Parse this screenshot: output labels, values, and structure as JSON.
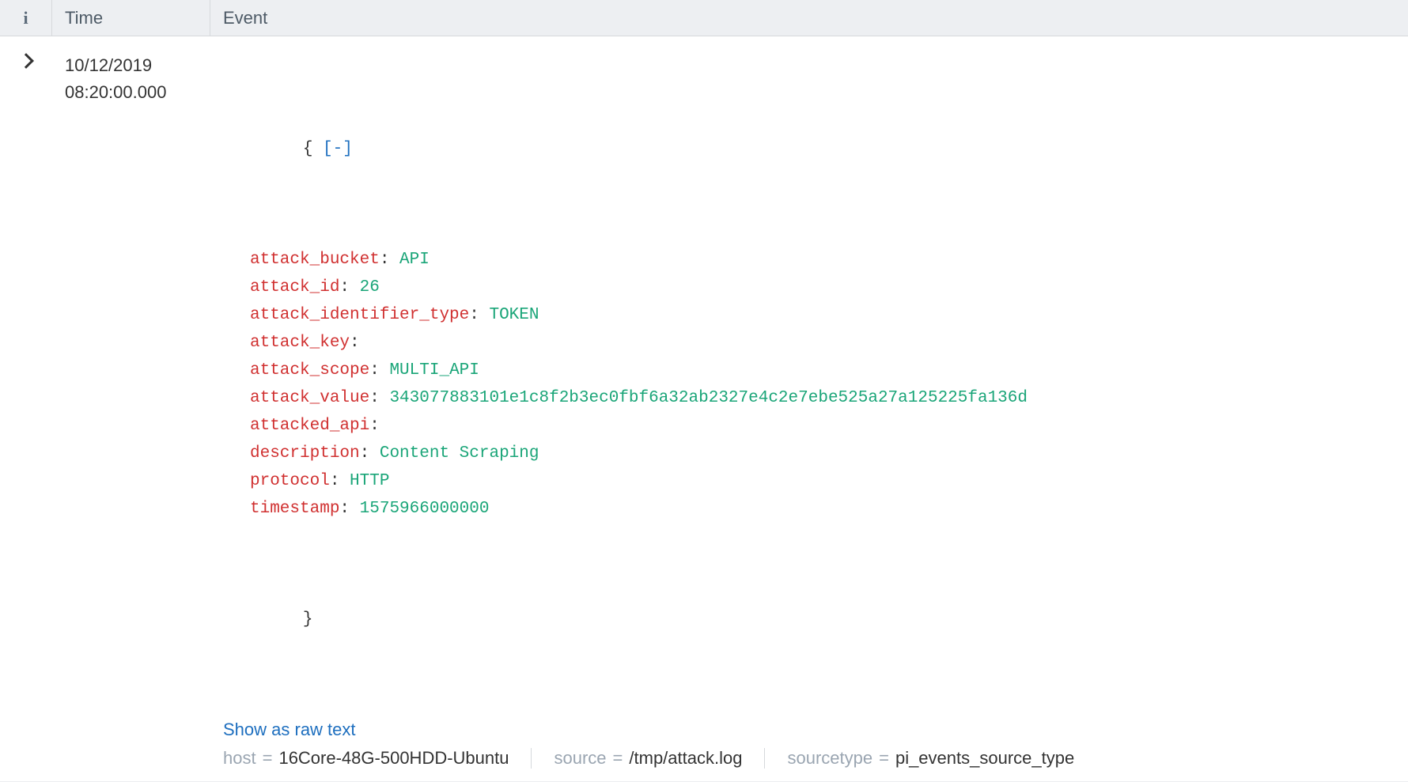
{
  "headers": {
    "info": "i",
    "time": "Time",
    "event": "Event"
  },
  "row": {
    "date": "10/12/2019",
    "time": "08:20:00.000",
    "json_open": "{",
    "json_close": "}",
    "toggle": "[-]",
    "fields": [
      {
        "k": "attack_bucket",
        "v": "API"
      },
      {
        "k": "attack_id",
        "v": "26"
      },
      {
        "k": "attack_identifier_type",
        "v": "TOKEN"
      },
      {
        "k": "attack_key",
        "v": ""
      },
      {
        "k": "attack_scope",
        "v": "MULTI_API"
      },
      {
        "k": "attack_value",
        "v": "343077883101e1c8f2b3ec0fbf6a32ab2327e4c2e7ebe525a27a125225fa136d"
      },
      {
        "k": "attacked_api",
        "v": ""
      },
      {
        "k": "description",
        "v": "Content Scraping"
      },
      {
        "k": "protocol",
        "v": "HTTP"
      },
      {
        "k": "timestamp",
        "v": "1575966000000"
      }
    ],
    "raw_text_label": "Show as raw text",
    "meta": {
      "host_label": "host",
      "host_value": "16Core-48G-500HDD-Ubuntu",
      "source_label": "source",
      "source_value": "/tmp/attack.log",
      "sourcetype_label": "sourcetype",
      "sourcetype_value": "pi_events_source_type",
      "eq": "="
    }
  }
}
